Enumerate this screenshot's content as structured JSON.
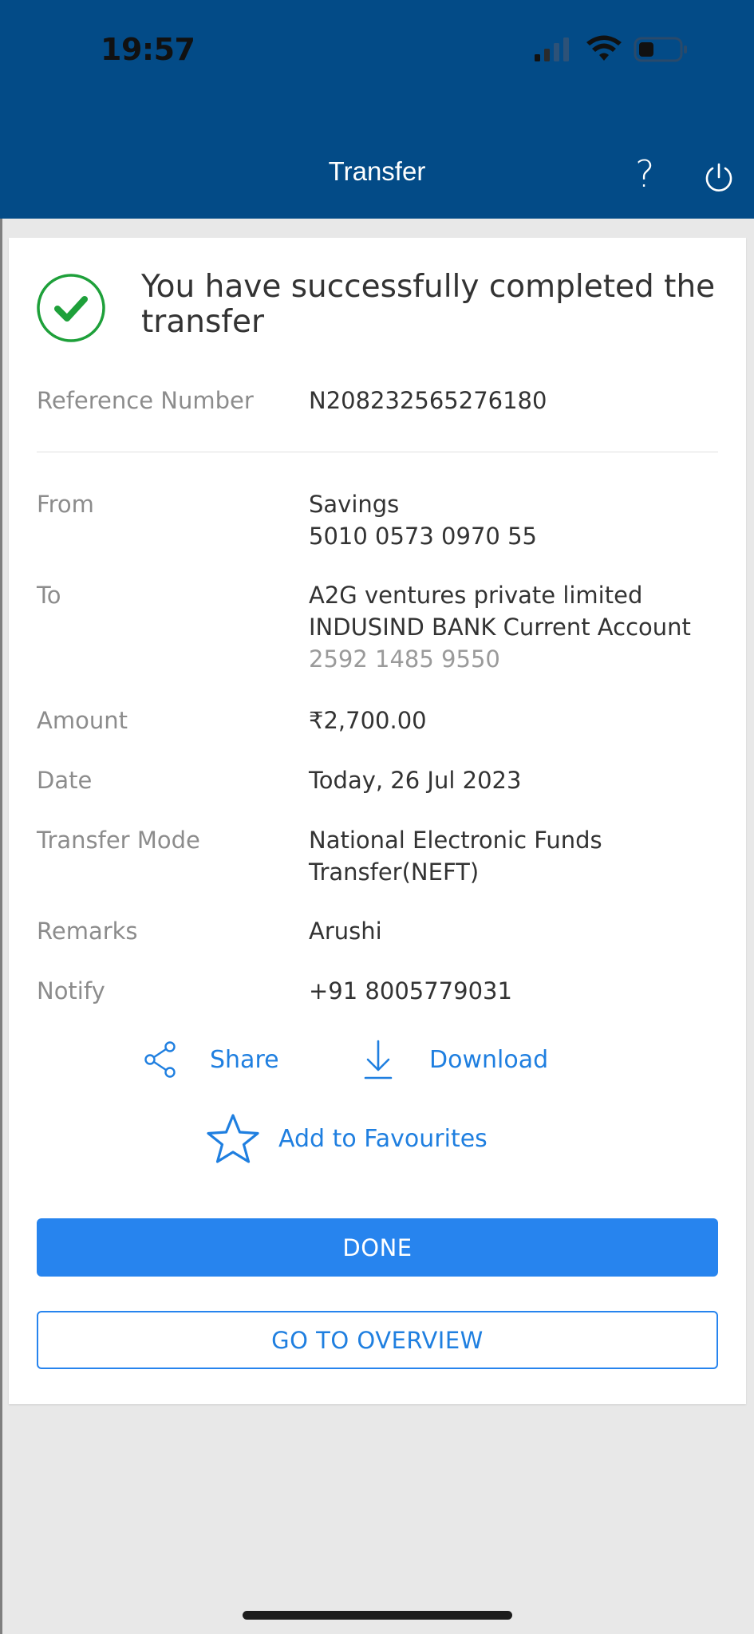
{
  "status_bar": {
    "time": "19:57",
    "signal_icon": "signal-icon",
    "wifi_icon": "wifi-icon",
    "battery_icon": "battery-icon"
  },
  "header": {
    "title": "Transfer",
    "help_label": "?",
    "power_icon": "power-icon",
    "background_color": "#034b87"
  },
  "confirmation": {
    "message": "You have successfully completed the transfer",
    "icon": "check-circle-icon",
    "icon_color": "#1ea03a"
  },
  "details": {
    "reference": {
      "label": "Reference Number",
      "value": "N208232565276180"
    },
    "from": {
      "label": "From",
      "account_type": "Savings",
      "account_number": "5010 0573 0970 55"
    },
    "to": {
      "label": "To",
      "name": "A2G ventures private limited",
      "bank": "INDUSIND BANK Current Account",
      "account_number": "2592 1485 9550"
    },
    "amount": {
      "label": "Amount",
      "value": "₹2,700.00"
    },
    "date": {
      "label": "Date",
      "value": "Today, 26 Jul 2023"
    },
    "mode": {
      "label": "Transfer Mode",
      "line1": "National Electronic Funds",
      "line2": "Transfer(NEFT)"
    },
    "remarks": {
      "label": "Remarks",
      "value": "Arushi"
    },
    "notify": {
      "label": "Notify",
      "value": "+91 8005779031"
    }
  },
  "actions": {
    "share_label": "Share",
    "download_label": "Download",
    "favourite_label": "Add to Favourites"
  },
  "buttons": {
    "done_label": "DONE",
    "overview_label": "GO TO OVERVIEW",
    "primary_color": "#2784ee"
  }
}
